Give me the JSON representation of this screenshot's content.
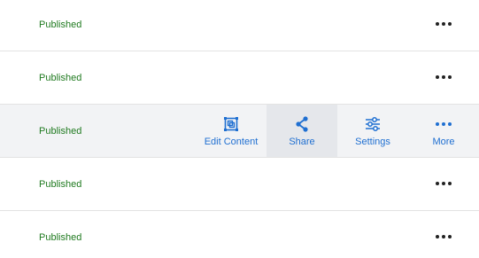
{
  "rows": [
    {
      "status": "Published"
    },
    {
      "status": "Published"
    },
    {
      "status": "Published"
    },
    {
      "status": "Published"
    },
    {
      "status": "Published"
    }
  ],
  "hover_actions": {
    "edit_content": "Edit Content",
    "share": "Share",
    "settings": "Settings",
    "more": "More"
  },
  "colors": {
    "status_text": "#1f7a1f",
    "action_accent": "#1f6fd1",
    "hover_row_bg": "#f2f3f5",
    "active_action_bg": "#e5e7eb",
    "divider": "#e3e3e3"
  },
  "icons": {
    "edit_content": "edit-content-icon",
    "share": "share-icon",
    "settings": "settings-sliders-icon",
    "more": "ellipsis-icon"
  }
}
